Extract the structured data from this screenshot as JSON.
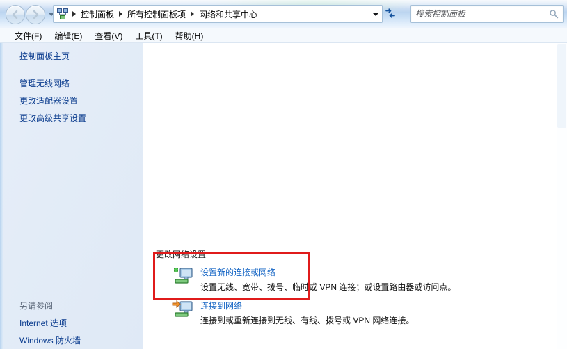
{
  "window": {
    "title": "网络和共享中心"
  },
  "nav": {
    "back_label": "后退",
    "forward_label": "前进",
    "dropdown_label": "最近访问的位置",
    "refresh_label": "刷新",
    "breadcrumb_icon": "network-sharing-icon",
    "breadcrumbs": [
      "控制面板",
      "所有控制面板项",
      "网络和共享中心"
    ]
  },
  "search": {
    "placeholder": "搜索控制面板",
    "value": "",
    "icon": "search-icon"
  },
  "menubar": {
    "items": [
      {
        "label": "文件(F)"
      },
      {
        "label": "编辑(E)"
      },
      {
        "label": "查看(V)"
      },
      {
        "label": "工具(T)"
      },
      {
        "label": "帮助(H)"
      }
    ]
  },
  "sidebar": {
    "home_label": "控制面板主页",
    "items": [
      {
        "label": "管理无线网络"
      },
      {
        "label": "更改适配器设置"
      },
      {
        "label": "更改高级共享设置"
      }
    ],
    "see_also": {
      "title": "另请参阅",
      "items": [
        {
          "label": "Internet 选项"
        },
        {
          "label": "Windows 防火墙"
        }
      ]
    }
  },
  "main": {
    "section_title": "更改网络设置",
    "tasks": [
      {
        "icon": "add-network-connection-icon",
        "link": "设置新的连接或网络",
        "desc": "设置无线、宽带、拨号、临时或 VPN 连接；或设置路由器或访问点。"
      },
      {
        "icon": "connect-to-network-icon",
        "link": "连接到网络",
        "desc": "连接到或重新连接到无线、有线、拨号或 VPN 网络连接。"
      }
    ]
  },
  "annotation": {
    "highlight_color": "#e01b1b",
    "label": "highlight-rectangle"
  }
}
